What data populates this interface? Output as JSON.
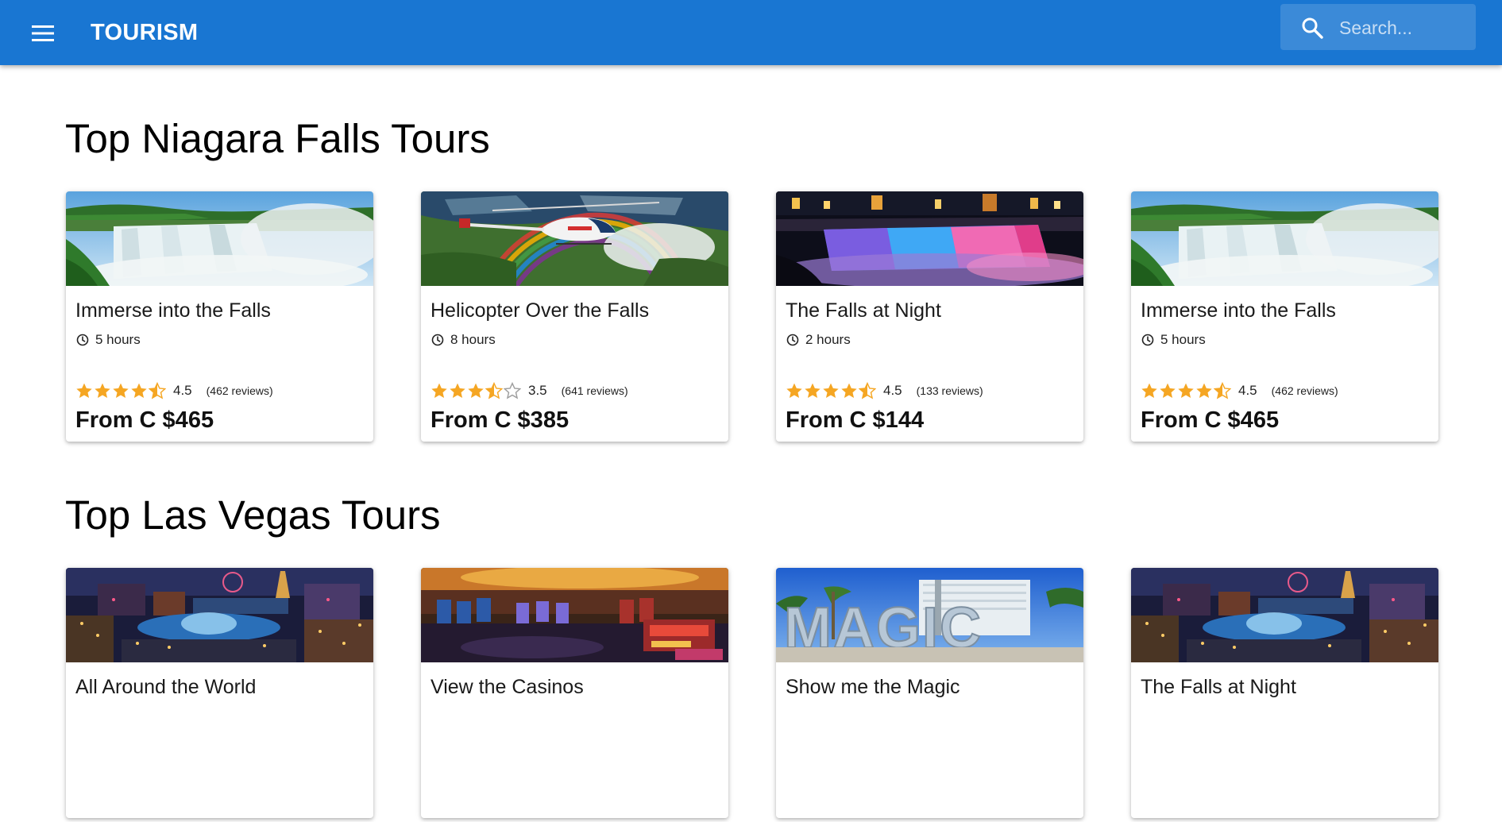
{
  "appbar": {
    "menu_icon": "menu-icon",
    "title": "TOURISM",
    "search": {
      "placeholder": "Search...",
      "value": "",
      "icon": "search-icon"
    },
    "color": "#1976d2"
  },
  "sections": [
    {
      "title": "Top Niagara Falls Tours",
      "tours": [
        {
          "image": "niagara-falls-day",
          "title": "Immerse into the Falls",
          "duration": "5 hours",
          "rating": 4.5,
          "rating_label": "4.5",
          "reviews": "(462 reviews)",
          "price": "From C $465"
        },
        {
          "image": "helicopter-rainbow",
          "title": "Helicopter Over the Falls",
          "duration": "8 hours",
          "rating": 3.5,
          "rating_label": "3.5",
          "reviews": "(641 reviews)",
          "price": "From C $385"
        },
        {
          "image": "falls-night-lights",
          "title": "The Falls at Night",
          "duration": "2 hours",
          "rating": 4.5,
          "rating_label": "4.5",
          "reviews": "(133 reviews)",
          "price": "From C $144"
        },
        {
          "image": "niagara-falls-day",
          "title": "Immerse into the Falls",
          "duration": "5 hours",
          "rating": 4.5,
          "rating_label": "4.5",
          "reviews": "(462 reviews)",
          "price": "From C $465"
        }
      ]
    },
    {
      "title": "Top Las Vegas Tours",
      "tours": [
        {
          "image": "vegas-strip-night",
          "title": "All Around the World"
        },
        {
          "image": "casino-floor",
          "title": "View the Casinos"
        },
        {
          "image": "magic-sign",
          "title": "Show me the Magic"
        },
        {
          "image": "vegas-strip-night",
          "title": "The Falls at Night"
        }
      ]
    }
  ],
  "colors": {
    "star": "#f5a623",
    "star_empty": "#9e9e9e"
  }
}
